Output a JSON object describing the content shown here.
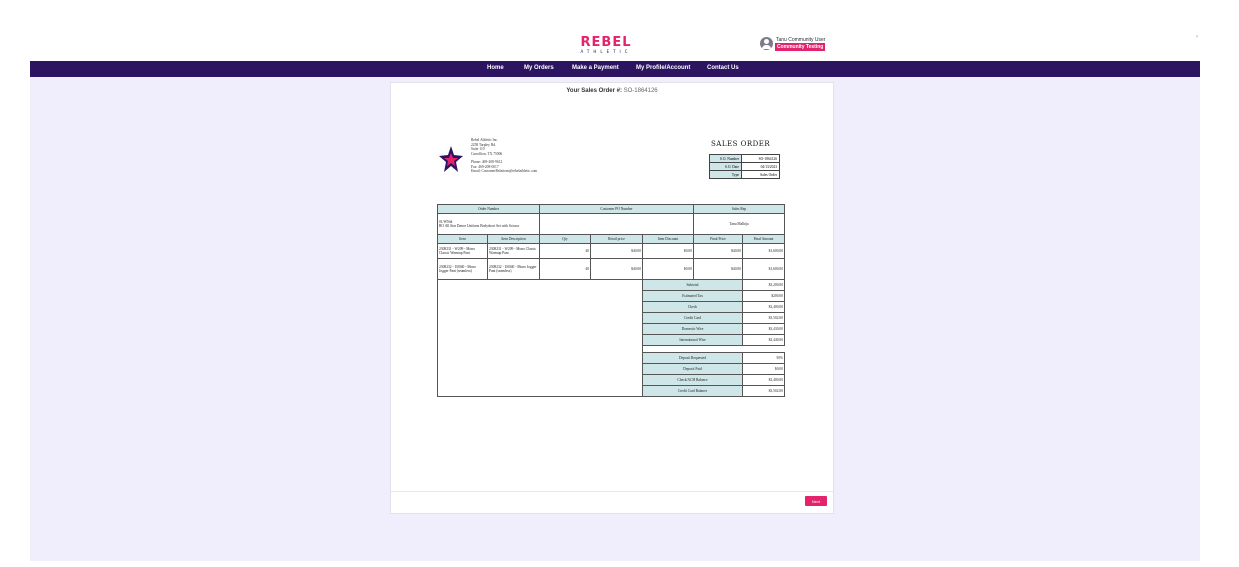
{
  "brand": {
    "main": "REBEL",
    "sub": "ATHLETIC"
  },
  "user": {
    "name": "Tanu Community User",
    "badge": "Community Testing"
  },
  "nav": {
    "items": [
      {
        "label": "Home"
      },
      {
        "label": "My Orders"
      },
      {
        "label": "Make a Payment"
      },
      {
        "label": "My Profile/Account"
      },
      {
        "label": "Contact Us"
      }
    ]
  },
  "order": {
    "header_label": "Your Sales Order #:",
    "header_value": "SO-1864126"
  },
  "company": {
    "name": "Rebel Athletic Inc.",
    "address1": "2258 Tarpley Rd.",
    "address2": "Suite 110",
    "city": "Carrollton, TX 75006",
    "phone": "Phone: 469-208-9612",
    "fax": "Fax: 469-208-0017",
    "email": "Email: CustomerRelations@rebelathletic.com"
  },
  "sales_order": {
    "title": "SALES ORDER",
    "rows": [
      {
        "k": "S.O. Number",
        "v": "SO-1864126"
      },
      {
        "k": "S.O. Date",
        "v": "04/13/2023"
      },
      {
        "k": "Type",
        "v": "Sales Order"
      }
    ]
  },
  "headers": {
    "order_number": "Order Number",
    "customer_po": "Customer PO Number",
    "sales_rep": "Sales Rep"
  },
  "order_info": {
    "order_number": "01/WNdt",
    "order_desc": "RO All Star Dance Uniform Bodyshort Set with Scissor",
    "customer_po": "",
    "sales_rep": "Tanu Malhija"
  },
  "items": {
    "columns": [
      "Item",
      "Item Description",
      "Qty",
      "Retail price",
      "Item Discount",
      "Final Price",
      "Final Amount"
    ],
    "rows": [
      [
        "2308231 - W209 - Mono Classic Warmup Pant",
        "2308231 - W209 - Mono Classic Warmup Pant",
        "40",
        "$40.00",
        "$0.00",
        "$40.00",
        "$1,600.00"
      ],
      [
        "2308232 - U0040 - Mono Jogger Pant (seamless)",
        "2308232 - U0040 - Mono Jogger Pant (seamless)",
        "40",
        "$40.00",
        "$0.00",
        "$40.00",
        "$1,600.00"
      ]
    ]
  },
  "totals": [
    {
      "k": "Subtotal",
      "v": "$3,200.00"
    },
    {
      "k": "Estimated Tax",
      "v": "$200.00"
    },
    {
      "k": "Check",
      "v": "$3,400.00"
    },
    {
      "k": "Credit Card",
      "v": "$3,502.00"
    },
    {
      "k": "Domestic Wire",
      "v": "$3,430.00"
    },
    {
      "k": "International Wire",
      "v": "$3,440.00"
    }
  ],
  "deposit": [
    {
      "k": "Deposit Requested",
      "v": "50%"
    },
    {
      "k": "Deposit Paid",
      "v": "$0.00"
    },
    {
      "k": "Check/ACH Balance",
      "v": "$3,400.00"
    },
    {
      "k": "Credit Card Balance",
      "v": "$3,502.00"
    }
  ],
  "next_label": "Next",
  "colors": {
    "brand_pink": "#e3246c",
    "nav_purple": "#2c1461",
    "backdrop": "#f0edfd",
    "table_header": "#cfe6e8"
  }
}
